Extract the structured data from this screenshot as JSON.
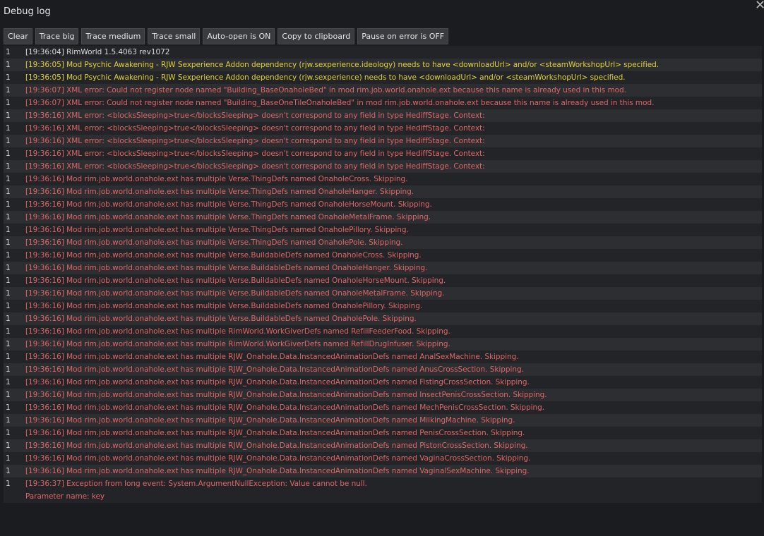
{
  "window": {
    "title": "Debug log",
    "close_glyph": "✕",
    "colors": {
      "background": "#1b1c1f",
      "info": "#dcdcdc",
      "warning": "#e0d23a",
      "error": "#e06666"
    }
  },
  "toolbar": {
    "clear": "Clear",
    "trace_big": "Trace big",
    "trace_medium": "Trace medium",
    "trace_small": "Trace small",
    "auto_open": "Auto-open is ON",
    "copy": "Copy to clipboard",
    "pause_on_error": "Pause on error is OFF"
  },
  "log": [
    {
      "count": "1",
      "level": "info",
      "text": "[19:36:04] RimWorld 1.5.4063 rev1072"
    },
    {
      "count": "1",
      "level": "warn",
      "text": "[19:36:05] Mod Psychic Awakening - RJW Sexperience Addon dependency (rjw.sexperience.ideology) needs to have <downloadUrl> and/or <steamWorkshopUrl> specified."
    },
    {
      "count": "1",
      "level": "warn",
      "text": "[19:36:05] Mod Psychic Awakening - RJW Sexperience Addon dependency (rjw.sexperience) needs to have <downloadUrl> and/or <steamWorkshopUrl> specified."
    },
    {
      "count": "1",
      "level": "err",
      "text": "[19:36:07] XML error: Could not register node named \"Building_BaseOnaholeBed\" in mod rim.job.world.onahole.ext because this name is already used in this mod."
    },
    {
      "count": "1",
      "level": "err",
      "text": "[19:36:07] XML error: Could not register node named \"Building_BaseOneTileOnaholeBed\" in mod rim.job.world.onahole.ext because this name is already used in this mod."
    },
    {
      "count": "1",
      "level": "err",
      "text": "[19:36:16] XML error: <blocksSleeping>true</blocksSleeping> doesn't correspond to any field in type HediffStage. Context:"
    },
    {
      "count": "1",
      "level": "err",
      "text": "[19:36:16] XML error: <blocksSleeping>true</blocksSleeping> doesn't correspond to any field in type HediffStage. Context:"
    },
    {
      "count": "1",
      "level": "err",
      "text": "[19:36:16] XML error: <blocksSleeping>true</blocksSleeping> doesn't correspond to any field in type HediffStage. Context:"
    },
    {
      "count": "1",
      "level": "err",
      "text": "[19:36:16] XML error: <blocksSleeping>true</blocksSleeping> doesn't correspond to any field in type HediffStage. Context:"
    },
    {
      "count": "1",
      "level": "err",
      "text": "[19:36:16] XML error: <blocksSleeping>true</blocksSleeping> doesn't correspond to any field in type HediffStage. Context:"
    },
    {
      "count": "1",
      "level": "err",
      "text": "[19:36:16] Mod rim.job.world.onahole.ext has multiple Verse.ThingDefs named OnaholeCross. Skipping."
    },
    {
      "count": "1",
      "level": "err",
      "text": "[19:36:16] Mod rim.job.world.onahole.ext has multiple Verse.ThingDefs named OnaholeHanger. Skipping."
    },
    {
      "count": "1",
      "level": "err",
      "text": "[19:36:16] Mod rim.job.world.onahole.ext has multiple Verse.ThingDefs named OnaholeHorseMount. Skipping."
    },
    {
      "count": "1",
      "level": "err",
      "text": "[19:36:16] Mod rim.job.world.onahole.ext has multiple Verse.ThingDefs named OnaholeMetalFrame. Skipping."
    },
    {
      "count": "1",
      "level": "err",
      "text": "[19:36:16] Mod rim.job.world.onahole.ext has multiple Verse.ThingDefs named OnaholePillory. Skipping."
    },
    {
      "count": "1",
      "level": "err",
      "text": "[19:36:16] Mod rim.job.world.onahole.ext has multiple Verse.ThingDefs named OnaholePole. Skipping."
    },
    {
      "count": "1",
      "level": "err",
      "text": "[19:36:16] Mod rim.job.world.onahole.ext has multiple Verse.BuildableDefs named OnaholeCross. Skipping."
    },
    {
      "count": "1",
      "level": "err",
      "text": "[19:36:16] Mod rim.job.world.onahole.ext has multiple Verse.BuildableDefs named OnaholeHanger. Skipping."
    },
    {
      "count": "1",
      "level": "err",
      "text": "[19:36:16] Mod rim.job.world.onahole.ext has multiple Verse.BuildableDefs named OnaholeHorseMount. Skipping."
    },
    {
      "count": "1",
      "level": "err",
      "text": "[19:36:16] Mod rim.job.world.onahole.ext has multiple Verse.BuildableDefs named OnaholeMetalFrame. Skipping."
    },
    {
      "count": "1",
      "level": "err",
      "text": "[19:36:16] Mod rim.job.world.onahole.ext has multiple Verse.BuildableDefs named OnaholePillory. Skipping."
    },
    {
      "count": "1",
      "level": "err",
      "text": "[19:36:16] Mod rim.job.world.onahole.ext has multiple Verse.BuildableDefs named OnaholePole. Skipping."
    },
    {
      "count": "1",
      "level": "err",
      "text": "[19:36:16] Mod rim.job.world.onahole.ext has multiple RimWorld.WorkGiverDefs named RefillFeederFood. Skipping."
    },
    {
      "count": "1",
      "level": "err",
      "text": "[19:36:16] Mod rim.job.world.onahole.ext has multiple RimWorld.WorkGiverDefs named RefillDrugInfuser. Skipping."
    },
    {
      "count": "1",
      "level": "err",
      "text": "[19:36:16] Mod rim.job.world.onahole.ext has multiple RJW_Onahole.Data.InstancedAnimationDefs named AnalSexMachine. Skipping."
    },
    {
      "count": "1",
      "level": "err",
      "text": "[19:36:16] Mod rim.job.world.onahole.ext has multiple RJW_Onahole.Data.InstancedAnimationDefs named AnusCrossSection. Skipping."
    },
    {
      "count": "1",
      "level": "err",
      "text": "[19:36:16] Mod rim.job.world.onahole.ext has multiple RJW_Onahole.Data.InstancedAnimationDefs named FistingCrossSection. Skipping."
    },
    {
      "count": "1",
      "level": "err",
      "text": "[19:36:16] Mod rim.job.world.onahole.ext has multiple RJW_Onahole.Data.InstancedAnimationDefs named InsectPenisCrossSection. Skipping."
    },
    {
      "count": "1",
      "level": "err",
      "text": "[19:36:16] Mod rim.job.world.onahole.ext has multiple RJW_Onahole.Data.InstancedAnimationDefs named MechPenisCrossSection. Skipping."
    },
    {
      "count": "1",
      "level": "err",
      "text": "[19:36:16] Mod rim.job.world.onahole.ext has multiple RJW_Onahole.Data.InstancedAnimationDefs named MilkingMachine. Skipping."
    },
    {
      "count": "1",
      "level": "err",
      "text": "[19:36:16] Mod rim.job.world.onahole.ext has multiple RJW_Onahole.Data.InstancedAnimationDefs named PenisCrossSection. Skipping."
    },
    {
      "count": "1",
      "level": "err",
      "text": "[19:36:16] Mod rim.job.world.onahole.ext has multiple RJW_Onahole.Data.InstancedAnimationDefs named PistonCrossSection. Skipping."
    },
    {
      "count": "1",
      "level": "err",
      "text": "[19:36:16] Mod rim.job.world.onahole.ext has multiple RJW_Onahole.Data.InstancedAnimationDefs named VaginaCrossSection. Skipping."
    },
    {
      "count": "1",
      "level": "err",
      "text": "[19:36:16] Mod rim.job.world.onahole.ext has multiple RJW_Onahole.Data.InstancedAnimationDefs named VaginalSexMachine. Skipping."
    },
    {
      "count": "1",
      "level": "err",
      "text": "[19:36:37] Exception from long event: System.ArgumentNullException: Value cannot be null.",
      "text2": "Parameter name: key"
    }
  ]
}
